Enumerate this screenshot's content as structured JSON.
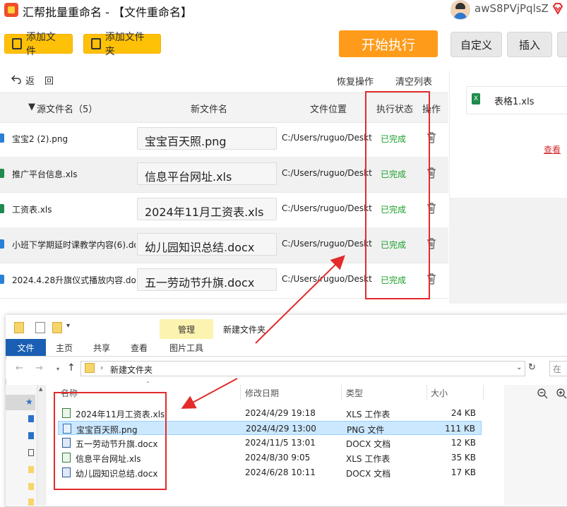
{
  "app": {
    "title": "汇帮批量重命名 - 【文件重命名】",
    "username": "awS8PVjPqlsZ",
    "logo_icon": "app-logo-icon",
    "vip_icon": "diamond-icon"
  },
  "toolbar": {
    "add_file": "添加文件",
    "add_folder": "添加文件夹",
    "start": "开始执行",
    "custom": "自定义",
    "insert": "插入",
    "back": "返回",
    "undo": "恢复操作",
    "clear": "清空列表"
  },
  "table": {
    "headers": {
      "source": "源文件名（5）",
      "new_name": "新文件名",
      "location": "文件位置",
      "status": "执行状态",
      "action": "操作"
    },
    "rows": [
      {
        "source": "宝宝2 (2).png",
        "new_name": "宝宝百天照.png",
        "location": "C:/Users/ruguo/Deskt",
        "status": "已完成"
      },
      {
        "source": "推广平台信息.xls",
        "new_name": "信息平台网址.xls",
        "location": "C:/Users/ruguo/Deskt",
        "status": "已完成"
      },
      {
        "source": "工资表.xls",
        "new_name": "2024年11月工资表.xls",
        "location": "C:/Users/ruguo/Deskt",
        "status": "已完成"
      },
      {
        "source": "小班下学期延时课教学内容(6).do",
        "new_name": "幼儿园知识总结.docx",
        "location": "C:/Users/ruguo/Deskt",
        "status": "已完成"
      },
      {
        "source": "2024.4.28升旗仪式播放内容.doc",
        "new_name": "五一劳动节升旗.docx",
        "location": "C:/Users/ruguo/Deskt",
        "status": "已完成"
      }
    ]
  },
  "right_panel": {
    "file_card": "表格1.xls",
    "link": "查看",
    "xls_badge": "X"
  },
  "explorer": {
    "manage_tab": "管理",
    "folder_title": "新建文件夹",
    "tabs": {
      "file": "文件",
      "home": "主页",
      "share": "共享",
      "view": "查看",
      "picture_tools": "图片工具"
    },
    "address": "新建文件夹",
    "search_placeholder": "在",
    "columns": {
      "name": "名称",
      "modified": "修改日期",
      "type": "类型",
      "size": "大小"
    },
    "files": [
      {
        "name": "2024年11月工资表.xls",
        "modified": "2024/4/29 19:18",
        "type": "XLS 工作表",
        "size": "24 KB",
        "kind": "xls"
      },
      {
        "name": "宝宝百天照.png",
        "modified": "2024/4/29 13:00",
        "type": "PNG 文件",
        "size": "111 KB",
        "kind": "png",
        "selected": true
      },
      {
        "name": "五一劳动节升旗.docx",
        "modified": "2024/11/5 13:01",
        "type": "DOCX 文档",
        "size": "12 KB",
        "kind": "doc"
      },
      {
        "name": "信息平台网址.xls",
        "modified": "2024/8/30 9:05",
        "type": "XLS 工作表",
        "size": "35 KB",
        "kind": "xls"
      },
      {
        "name": "幼儿园知识总结.docx",
        "modified": "2024/6/28 10:11",
        "type": "DOCX 文档",
        "size": "17 KB",
        "kind": "doc"
      }
    ]
  },
  "colors": {
    "accent_yellow": "#ffc107",
    "start_orange": "#ff9b1a",
    "status_green": "#19a02a",
    "annotation_red": "#e32b2b"
  }
}
